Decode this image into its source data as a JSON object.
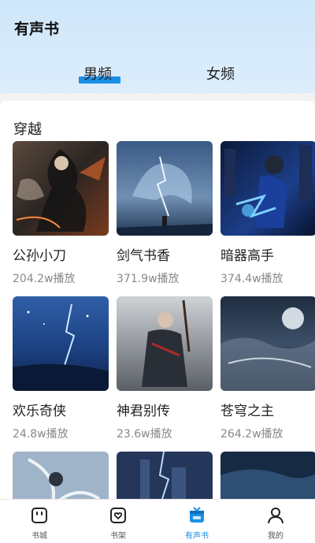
{
  "header": {
    "title": "有声书"
  },
  "tabs": [
    {
      "label": "男频",
      "active": true
    },
    {
      "label": "女频",
      "active": false
    }
  ],
  "accent_color": "#1a8fe6",
  "section": {
    "title": "穿越",
    "books": [
      {
        "title": "公孙小刀",
        "plays": "204.2w播放"
      },
      {
        "title": "剑气书香",
        "plays": "371.9w播放"
      },
      {
        "title": "暗器高手",
        "plays": "374.4w播放"
      },
      {
        "title": "欢乐奇侠",
        "plays": "24.8w播放"
      },
      {
        "title": "神君别传",
        "plays": "23.6w播放"
      },
      {
        "title": "苍穹之主",
        "plays": "264.2w播放"
      }
    ]
  },
  "bottom_nav": [
    {
      "label": "书城",
      "icon": "bookstore-icon",
      "active": false
    },
    {
      "label": "书架",
      "icon": "bookshelf-icon",
      "active": false
    },
    {
      "label": "有声书",
      "icon": "audiobook-icon",
      "active": true
    },
    {
      "label": "我的",
      "icon": "profile-icon",
      "active": false
    }
  ]
}
